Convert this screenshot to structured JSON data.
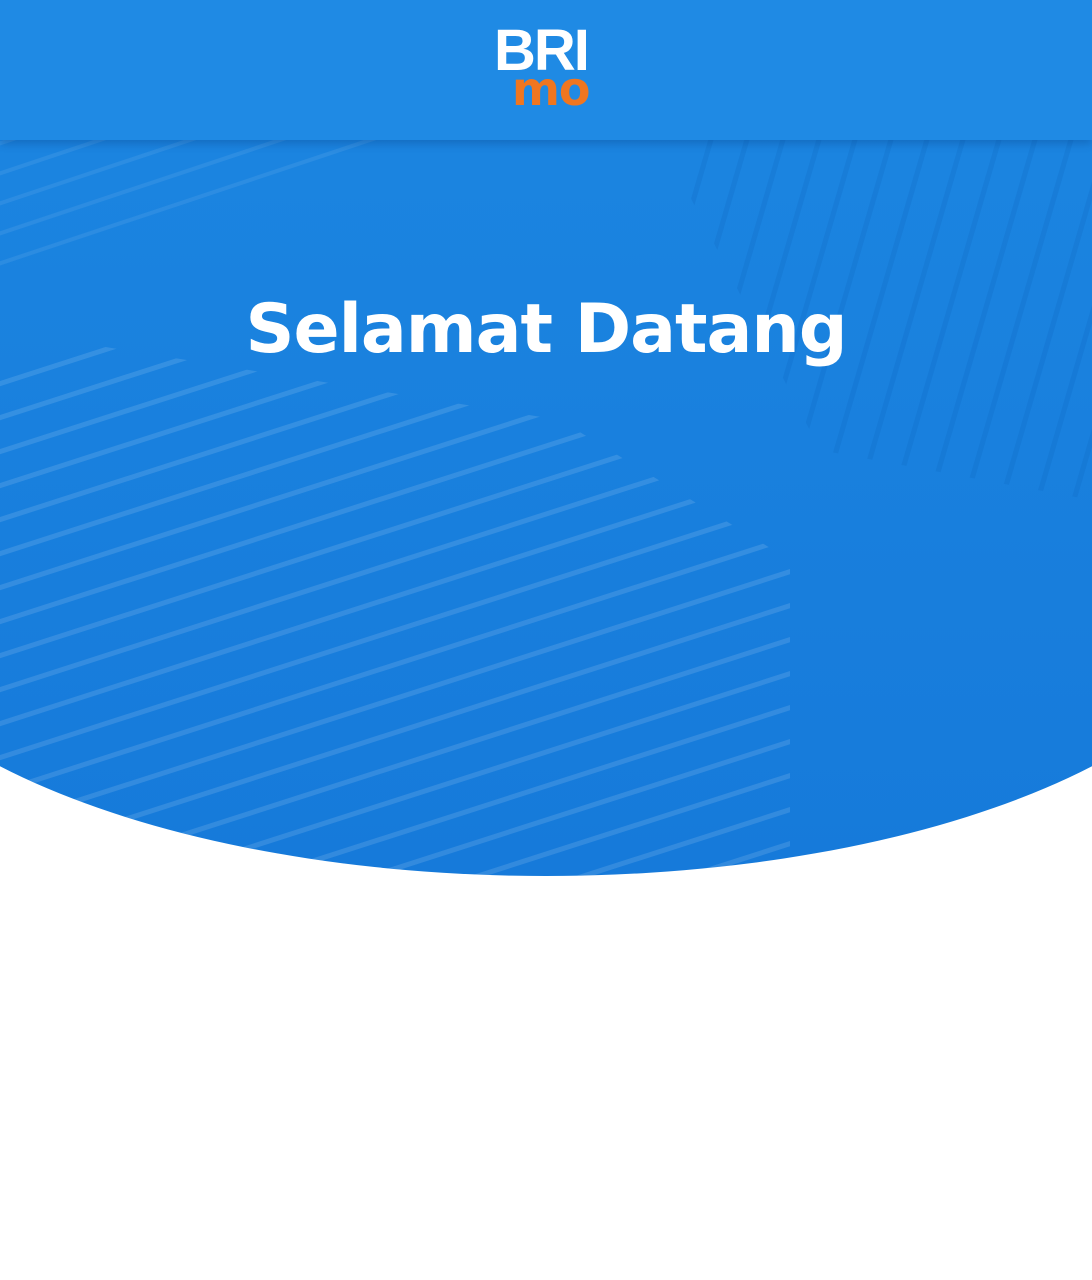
{
  "header": {
    "logo_primary": "BRI",
    "logo_secondary": "mo"
  },
  "hero": {
    "title": "Selamat Datang"
  },
  "colors": {
    "primary_blue": "#1f8ae4",
    "accent_orange": "#f0761f",
    "background": "#ffffff"
  }
}
